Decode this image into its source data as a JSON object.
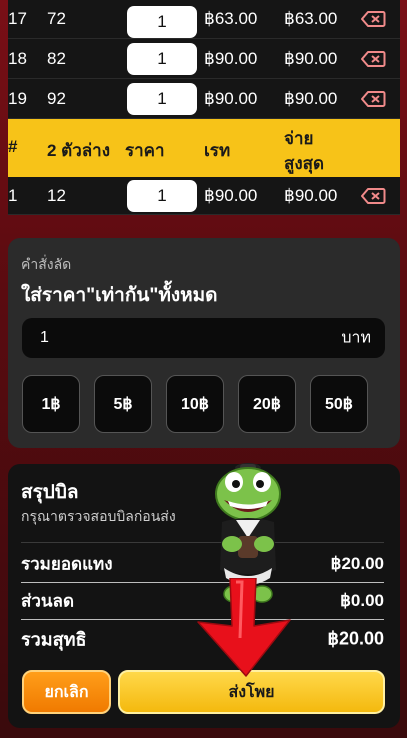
{
  "rows_top": [
    {
      "index": "17",
      "number": "72",
      "qty": "1",
      "rate": "฿63.00",
      "max_pay": "฿63.00"
    },
    {
      "index": "18",
      "number": "82",
      "qty": "1",
      "rate": "฿90.00",
      "max_pay": "฿90.00"
    },
    {
      "index": "19",
      "number": "92",
      "qty": "1",
      "rate": "฿90.00",
      "max_pay": "฿90.00"
    }
  ],
  "section_header": {
    "col_index": "#",
    "col_number": "2 ตัวล่าง",
    "col_price": "ราคา",
    "col_rate": "เรท",
    "col_max_line1": "จ่าย",
    "col_max_line2": "สูงสุด"
  },
  "rows_bottom": [
    {
      "index": "1",
      "number": "12",
      "qty": "1",
      "rate": "฿90.00",
      "max_pay": "฿90.00"
    }
  ],
  "shortcut": {
    "caption": "คำสั่งลัด",
    "title": "ใส่ราคา\"เท่ากัน\"ทั้งหมด",
    "input_value": "1",
    "unit": "บาท",
    "chips": [
      "1฿",
      "5฿",
      "10฿",
      "20฿",
      "50฿"
    ]
  },
  "summary": {
    "title": "สรุปบิล",
    "subtitle": "กรุณาตรวจสอบบิลก่อนส่ง",
    "total_label": "รวมยอดแทง",
    "total_value": "฿20.00",
    "discount_label": "ส่วนลด",
    "discount_value": "฿0.00",
    "net_label": "รวมสุทธิ",
    "net_value": "฿20.00",
    "cancel_label": "ยกเลิก",
    "submit_label": "ส่งโพย"
  },
  "colors": {
    "accent": "#f7c318",
    "delete_icon": "#f08a8a",
    "cancel": "#f5880c",
    "submit": "#f7c318"
  },
  "icons": {
    "delete": "backspace-x-icon",
    "mascot": "turtle-mascot",
    "pointer": "red-down-arrow"
  }
}
